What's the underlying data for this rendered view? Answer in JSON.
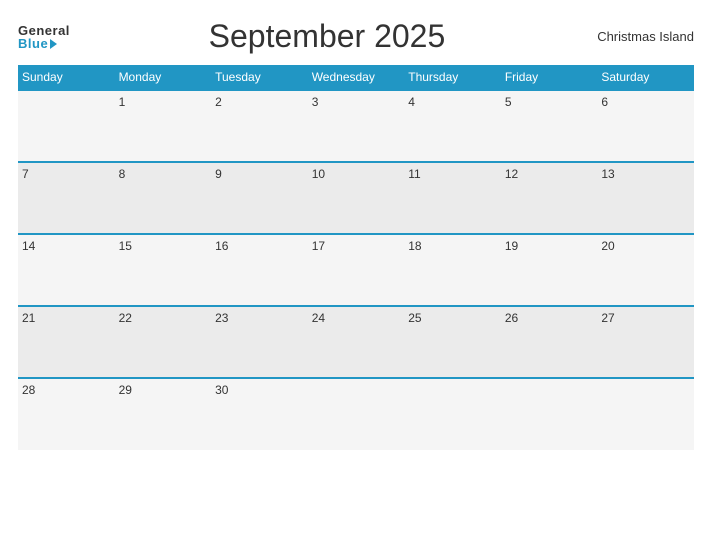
{
  "header": {
    "logo_general": "General",
    "logo_blue": "Blue",
    "title": "September 2025",
    "region": "Christmas Island"
  },
  "days_of_week": [
    "Sunday",
    "Monday",
    "Tuesday",
    "Wednesday",
    "Thursday",
    "Friday",
    "Saturday"
  ],
  "weeks": [
    [
      "",
      "1",
      "2",
      "3",
      "4",
      "5",
      "6"
    ],
    [
      "7",
      "8",
      "9",
      "10",
      "11",
      "12",
      "13"
    ],
    [
      "14",
      "15",
      "16",
      "17",
      "18",
      "19",
      "20"
    ],
    [
      "21",
      "22",
      "23",
      "24",
      "25",
      "26",
      "27"
    ],
    [
      "28",
      "29",
      "30",
      "",
      "",
      "",
      ""
    ]
  ]
}
